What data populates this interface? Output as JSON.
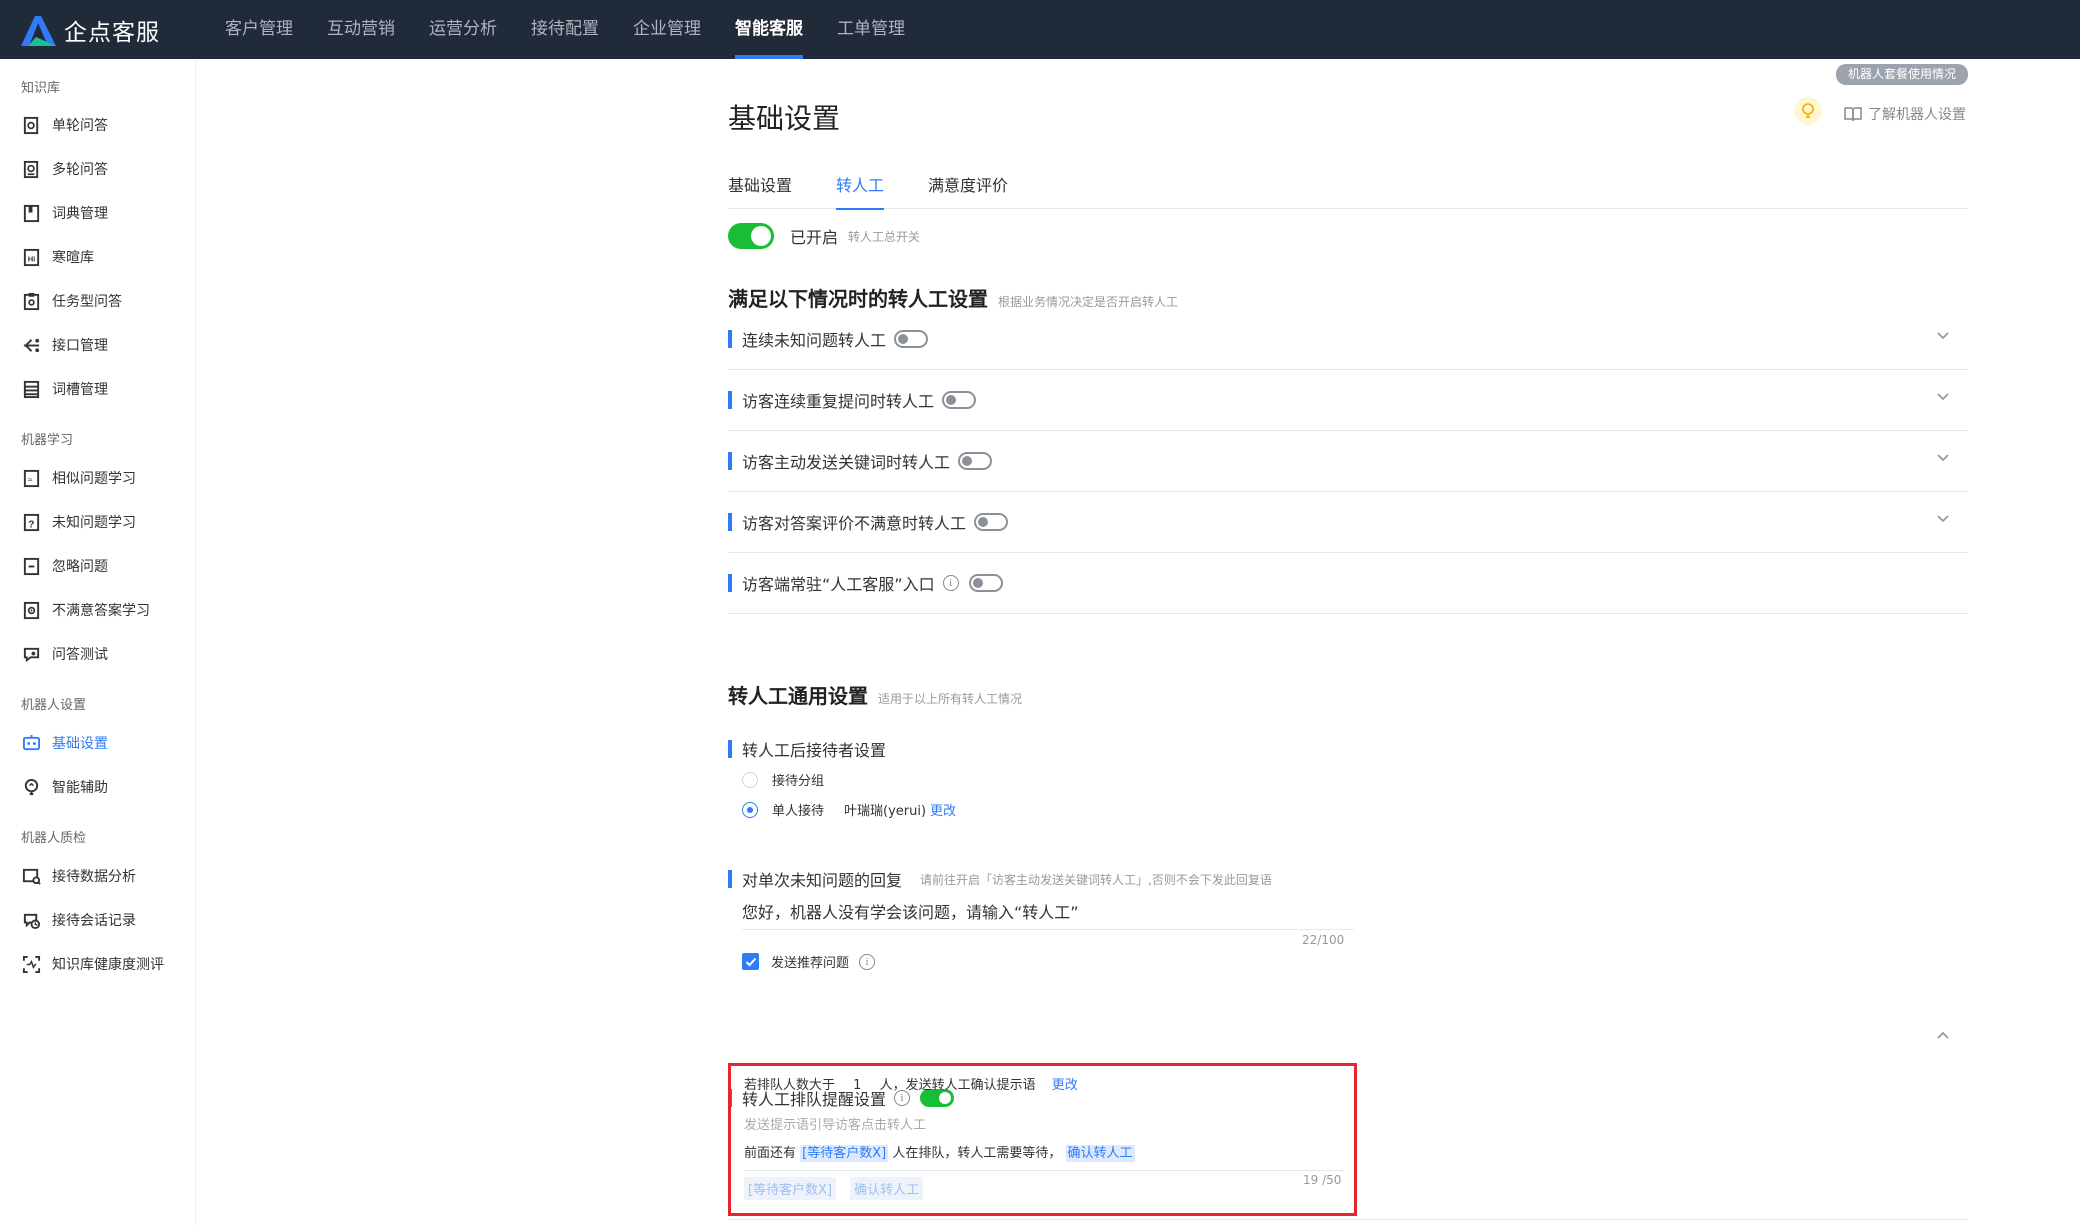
{
  "app": {
    "name": "企点客服"
  },
  "nav": [
    {
      "label": "客户管理"
    },
    {
      "label": "互动营销"
    },
    {
      "label": "运营分析"
    },
    {
      "label": "接待配置"
    },
    {
      "label": "企业管理"
    },
    {
      "label": "智能客服"
    },
    {
      "label": "工单管理"
    }
  ],
  "sidebar": {
    "groups": [
      {
        "title": "知识库"
      },
      {
        "title": "机器学习"
      },
      {
        "title": "机器人设置"
      },
      {
        "title": "机器人质检"
      }
    ],
    "items": [
      {
        "label": "单轮问答",
        "icon": "single-qa-icon"
      },
      {
        "label": "多轮问答",
        "icon": "multi-qa-icon"
      },
      {
        "label": "词典管理",
        "icon": "dictionary-icon"
      },
      {
        "label": "寒暄库",
        "icon": "chitchat-icon"
      },
      {
        "label": "任务型问答",
        "icon": "task-qa-icon"
      },
      {
        "label": "接口管理",
        "icon": "api-icon"
      },
      {
        "label": "词槽管理",
        "icon": "slot-icon"
      },
      {
        "label": "相似问题学习",
        "icon": "similar-icon"
      },
      {
        "label": "未知问题学习",
        "icon": "unknown-icon"
      },
      {
        "label": "忽略问题",
        "icon": "ignore-icon"
      },
      {
        "label": "不满意答案学习",
        "icon": "unsatisfied-icon"
      },
      {
        "label": "问答测试",
        "icon": "test-icon"
      },
      {
        "label": "基础设置",
        "icon": "robot-icon"
      },
      {
        "label": "智能辅助",
        "icon": "assist-icon"
      },
      {
        "label": "接待数据分析",
        "icon": "analysis-icon"
      },
      {
        "label": "接待会话记录",
        "icon": "record-icon"
      },
      {
        "label": "知识库健康度测评",
        "icon": "health-icon"
      }
    ]
  },
  "header": {
    "usage_badge": "机器人套餐使用情况",
    "title": "基础设置",
    "learn_link": "了解机器人设置"
  },
  "tabs": [
    {
      "label": "基础设置"
    },
    {
      "label": "转人工"
    },
    {
      "label": "满意度评价"
    }
  ],
  "master": {
    "label": "已开启",
    "hint": "转人工总开关",
    "enabled": true
  },
  "section1": {
    "title": "满足以下情况时的转人工设置",
    "hint": "根据业务情况决定是否开启转人工",
    "rules": [
      {
        "label": "连续未知问题转人工",
        "enabled": false
      },
      {
        "label": "访客连续重复提问时转人工",
        "enabled": false
      },
      {
        "label": "访客主动发送关键词时转人工",
        "enabled": false
      },
      {
        "label": "访客对答案评价不满意时转人工",
        "enabled": false
      },
      {
        "label": "访客端常驻“人工客服”入口",
        "enabled": false
      }
    ]
  },
  "section2": {
    "title": "转人工通用设置",
    "hint": "适用于以上所有转人工情况",
    "receiver": {
      "title": "转人工后接待者设置",
      "option_group": "接待分组",
      "option_single": "单人接待",
      "selected_agent": "叶瑞瑞(yerui)",
      "change": "更改"
    },
    "unknown_reply": {
      "title": "对单次未知问题的回复",
      "hint": "请前往开启「访客主动发送关键词转人工」,否则不会下发此回复语",
      "value": "您好，机器人没有学会该问题，请输入“转人工”",
      "counter": "22/100",
      "send_recommend": "发送推荐问题"
    },
    "queue": {
      "title": "转人工排队提醒设置",
      "enabled": true,
      "line_prefix": "若排队人数大于",
      "threshold": "1",
      "line_suffix": "人，发送转人工确认提示语",
      "change": "更改",
      "prompt_hint": "发送提示语引导访客点击转人工",
      "msg_prefix": "前面还有",
      "msg_var": "[等待客户数X]",
      "msg_middle": "人在排队，转人工需要等待，",
      "msg_action": "确认转人工",
      "chip_var": "[等待客户数X]",
      "chip_action": "确认转人工",
      "counter": "19 /50"
    }
  },
  "colors": {
    "accent": "#2f7cf6",
    "toggle_on": "#19be37",
    "nav_bg": "#212a38",
    "highlight_border": "#e6262c"
  }
}
